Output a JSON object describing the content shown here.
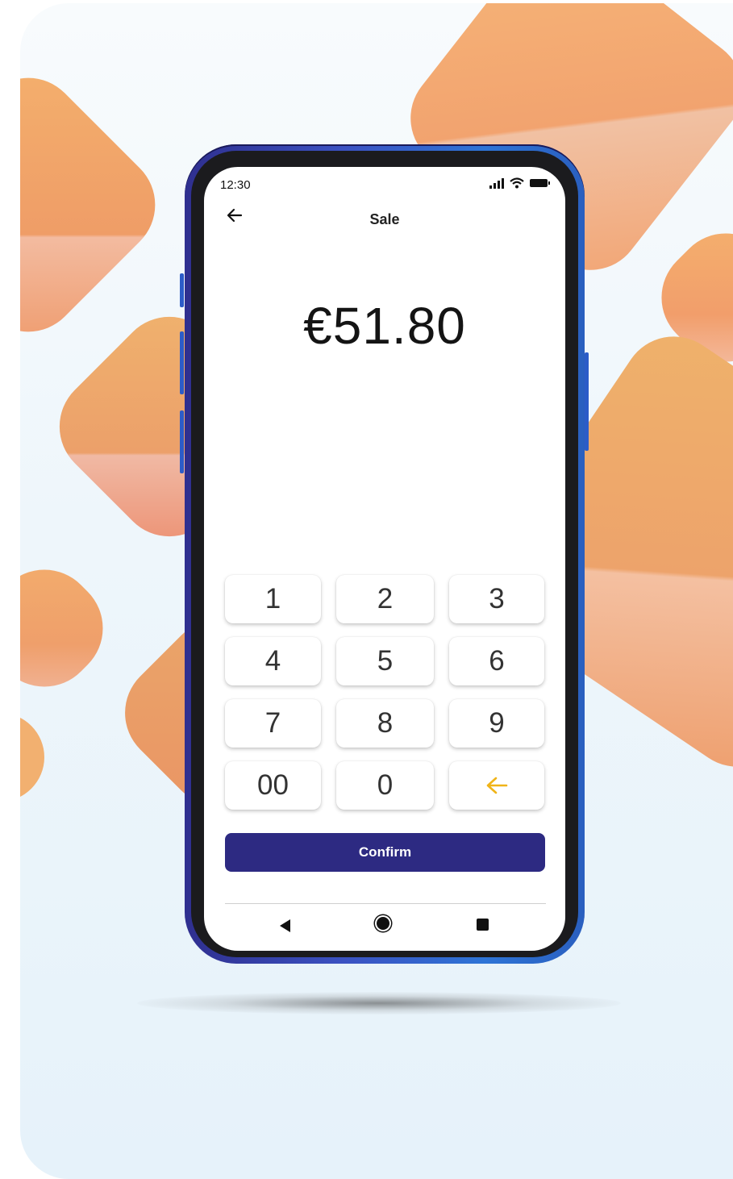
{
  "status_bar": {
    "time": "12:30",
    "icons": [
      "signal-icon",
      "wifi-icon",
      "battery-icon"
    ]
  },
  "header": {
    "title": "Sale",
    "back_icon": "arrow-left-icon"
  },
  "amount": "€51.80",
  "keypad": {
    "keys": [
      "1",
      "2",
      "3",
      "4",
      "5",
      "6",
      "7",
      "8",
      "9",
      "00",
      "0"
    ],
    "delete_icon": "arrow-left-icon",
    "delete_color": "#f0b419"
  },
  "confirm_label": "Confirm",
  "colors": {
    "confirm_bg": "#2d2a82",
    "accent": "#f0b419",
    "phone_frame": "#3b52c2"
  },
  "navbar": {
    "icons": [
      "nav-back-icon",
      "nav-home-icon",
      "nav-recents-icon"
    ]
  }
}
